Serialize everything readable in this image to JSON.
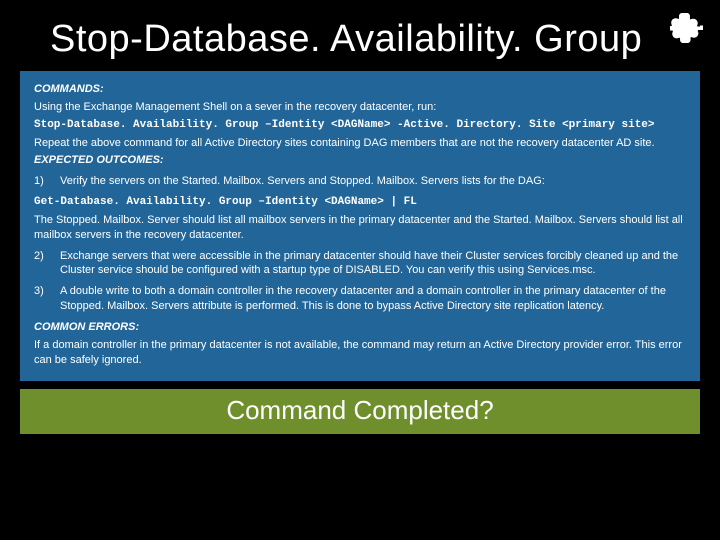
{
  "title": "Stop-Database. Availability. Group",
  "corner_icon": "puzzle-piece",
  "panel": {
    "commands_head": "COMMANDS:",
    "commands_intro": "Using the Exchange Management Shell on a sever in the recovery datacenter, run:",
    "command1": "Stop-Database. Availability. Group –Identity <DAGName> -Active. Directory. Site <primary site>",
    "commands_repeat": "Repeat the above command for all Active Directory sites containing DAG members that are not the recovery datacenter AD site.",
    "outcomes_head": "EXPECTED OUTCOMES:",
    "o1_num": "1)",
    "o1": "Verify the servers on the Started. Mailbox. Servers and Stopped. Mailbox. Servers lists for the DAG:",
    "command2": "Get-Database. Availability. Group –Identity <DAGName> | FL",
    "o1_after": "The Stopped. Mailbox. Server should list all mailbox servers in the primary datacenter and the Started. Mailbox. Servers should list all mailbox servers in the recovery datacenter.",
    "o2_num": "2)",
    "o2": "Exchange servers that were accessible in the primary datacenter should have their Cluster services forcibly cleaned up and the Cluster service should be configured with a startup type of DISABLED. You can verify this using Services.msc.",
    "o3_num": "3)",
    "o3": "A double write to both a domain controller in the recovery datacenter and a domain controller in the primary datacenter of the Stopped. Mailbox. Servers attribute is performed.  This is done to bypass Active Directory site replication latency.",
    "errors_head": "COMMON ERRORS:",
    "errors_body": "If a domain controller in the primary datacenter is not available, the command may return an Active Directory provider error.  This error can be safely ignored."
  },
  "footer": "Command Completed?"
}
